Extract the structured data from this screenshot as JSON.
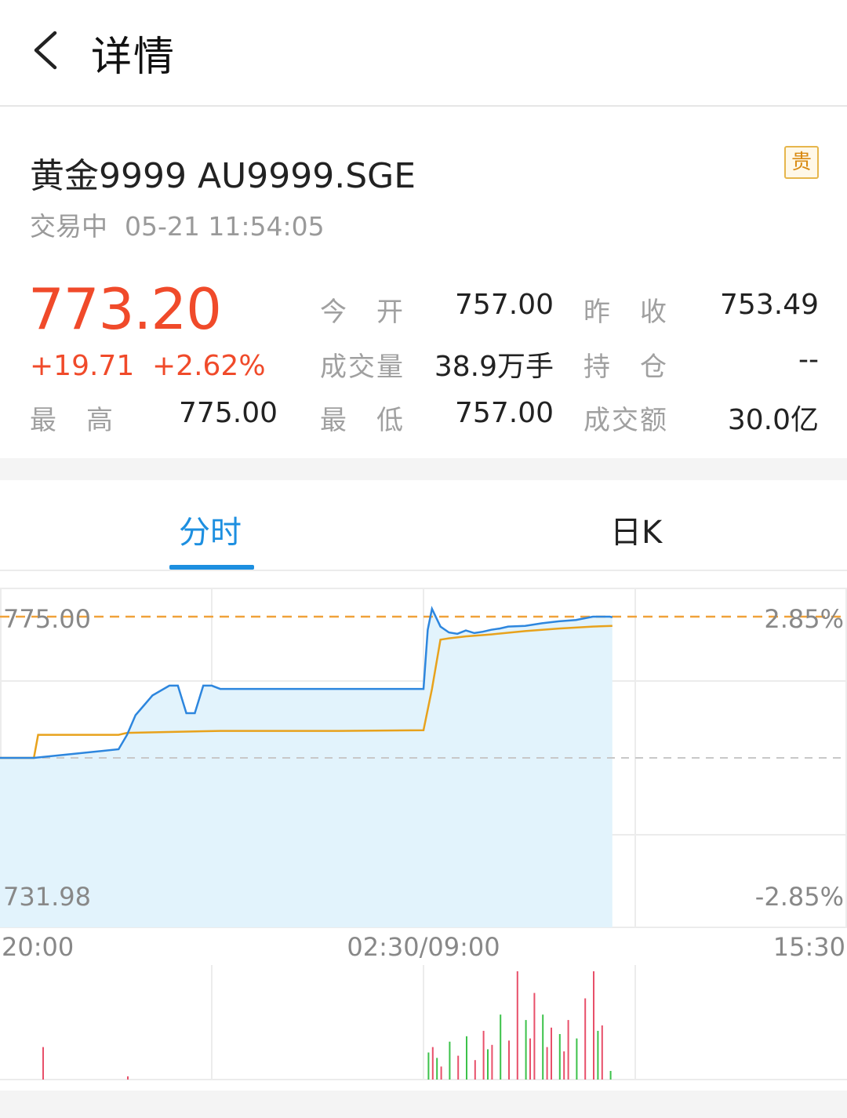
{
  "header": {
    "title": "详情",
    "back_icon": "chevron-left-icon"
  },
  "instrument": {
    "name": "黄金9999 AU9999.SGE",
    "badge": "贵",
    "status": "交易中",
    "timestamp": "05-21 11:54:05",
    "price": "773.20",
    "change": "+19.71",
    "change_pct": "+2.62%",
    "color_up": "#f04a2a"
  },
  "quote": {
    "open": {
      "label": "今　开",
      "value": "757.00"
    },
    "prev_close": {
      "label": "昨　收",
      "value": "753.49"
    },
    "volume": {
      "label": "成交量",
      "value": "38.9万手"
    },
    "open_interest": {
      "label": "持　仓",
      "value": "--"
    },
    "high": {
      "label": "最　高",
      "value": "775.00"
    },
    "low": {
      "label": "最　低",
      "value": "757.00"
    },
    "turnover": {
      "label": "成交额",
      "value": "30.0亿"
    }
  },
  "tabs": [
    {
      "label": "分时",
      "active": true
    },
    {
      "label": "日K",
      "active": false
    }
  ],
  "chart_data": {
    "type": "line",
    "ylim": [
      731.98,
      775.0
    ],
    "y_tick_labels": {
      "top_left": "775.00",
      "bottom_left": "731.98",
      "top_right": "2.85%",
      "bottom_right": "-2.85%"
    },
    "x_tick_labels": [
      "20:00",
      "02:30/09:00",
      "15:30"
    ],
    "prev_close": 753.49,
    "high_line": 775.0,
    "colors": {
      "price": "#2d86de",
      "avg": "#e8a21c",
      "fill": "#e2f3fc",
      "ref_dash": "#f0a23a",
      "zero_dash": "#c8c8c8",
      "vol_up": "#e8506a",
      "vol_down": "#3cc24a"
    },
    "series": [
      {
        "x": [
          0.0,
          0.04,
          0.14,
          0.15,
          0.16,
          0.17,
          0.18,
          0.2,
          0.21,
          0.22,
          0.23,
          0.24,
          0.25,
          0.26,
          0.3,
          0.4,
          0.48,
          0.5,
          0.505,
          0.51,
          0.52,
          0.53,
          0.54,
          0.55,
          0.56,
          0.57,
          0.58,
          0.59,
          0.6,
          0.62,
          0.64,
          0.66,
          0.68,
          0.7,
          0.72,
          0.723
        ],
        "values": [
          753.49,
          753.49,
          754.8,
          757.0,
          760.0,
          761.5,
          763.0,
          764.5,
          764.5,
          760.3,
          760.3,
          764.5,
          764.5,
          764.0,
          764.0,
          764.0,
          764.0,
          764.0,
          773.0,
          776.2,
          773.5,
          772.6,
          772.4,
          772.9,
          772.5,
          772.7,
          773.0,
          773.2,
          773.5,
          773.6,
          774.0,
          774.3,
          774.5,
          775.0,
          775.0,
          774.9
        ]
      },
      {
        "x": [
          0.0,
          0.04,
          0.045,
          0.14,
          0.15,
          0.26,
          0.4,
          0.5,
          0.51,
          0.52,
          0.53,
          0.55,
          0.58,
          0.62,
          0.66,
          0.7,
          0.723
        ],
        "values": [
          753.49,
          753.49,
          757.0,
          757.0,
          757.3,
          757.6,
          757.6,
          757.7,
          764.0,
          771.5,
          771.7,
          772.0,
          772.3,
          772.8,
          773.2,
          773.5,
          773.6
        ]
      }
    ],
    "volume": {
      "x": [
        0.05,
        0.15,
        0.505,
        0.51,
        0.515,
        0.52,
        0.53,
        0.54,
        0.55,
        0.56,
        0.57,
        0.575,
        0.58,
        0.59,
        0.6,
        0.61,
        0.62,
        0.625,
        0.63,
        0.64,
        0.645,
        0.65,
        0.66,
        0.665,
        0.67,
        0.68,
        0.69,
        0.7,
        0.705,
        0.71,
        0.72
      ],
      "values": [
        30,
        3,
        25,
        30,
        20,
        12,
        35,
        22,
        40,
        18,
        45,
        28,
        32,
        60,
        36,
        100,
        55,
        38,
        80,
        60,
        30,
        48,
        42,
        26,
        55,
        38,
        75,
        100,
        45,
        50,
        8
      ],
      "up": [
        true,
        true,
        false,
        true,
        false,
        true,
        false,
        true,
        false,
        true,
        true,
        false,
        true,
        false,
        true,
        true,
        false,
        true,
        true,
        false,
        true,
        true,
        false,
        true,
        true,
        false,
        true,
        true,
        false,
        true,
        false
      ]
    }
  }
}
